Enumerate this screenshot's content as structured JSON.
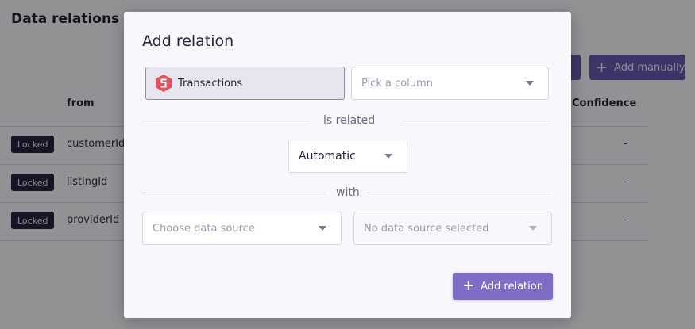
{
  "background": {
    "title": "Data relations  »  Tr",
    "buttons": {
      "ghost_label": "s",
      "add_manually": "Add manually"
    },
    "columns": {
      "from": "from",
      "confidence": "Confidence"
    },
    "rows": [
      {
        "badge": "Locked",
        "from": "customerId",
        "confidence": "-"
      },
      {
        "badge": "Locked",
        "from": "listingId",
        "confidence": "-"
      },
      {
        "badge": "Locked",
        "from": "providerId",
        "confidence": "-"
      }
    ]
  },
  "modal": {
    "title": "Add relation",
    "source": {
      "name": "Transactions",
      "logo": "transactions-logo-icon"
    },
    "column_picker": {
      "placeholder": "Pick a column"
    },
    "is_related_label": "is related",
    "relation_type": {
      "value": "Automatic"
    },
    "with_label": "with",
    "target_source": {
      "placeholder": "Choose data source"
    },
    "target_column": {
      "placeholder": "No data source selected"
    },
    "submit_label": "Add relation",
    "colors": {
      "accent": "#7e6cc7",
      "logo": "#e0535c"
    }
  }
}
